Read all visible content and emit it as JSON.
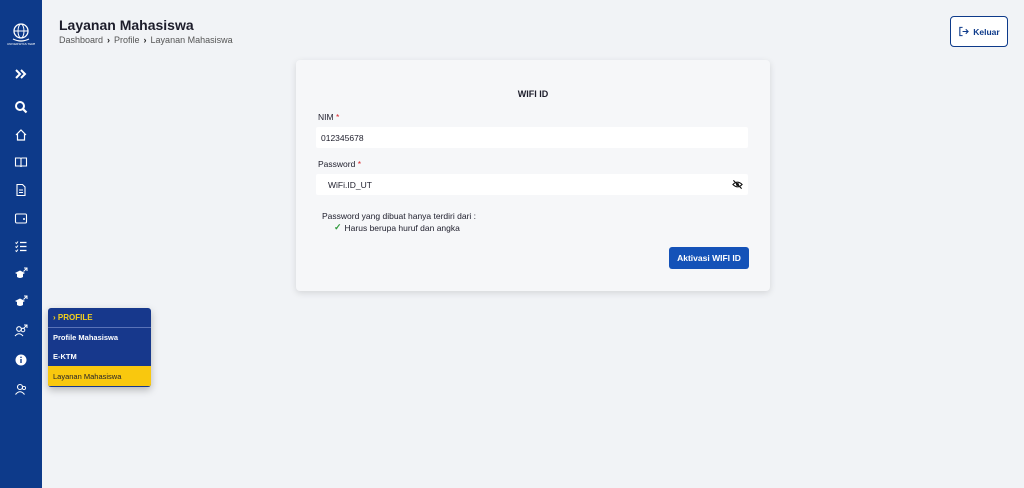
{
  "app": {
    "logo_text": "UNIVERSITAS TERBUKA",
    "logo_icon": "globe-emblem-icon"
  },
  "sidebar": {
    "items": [
      {
        "icon": "expand-chevrons-icon"
      },
      {
        "icon": "search-icon"
      },
      {
        "icon": "home-icon"
      },
      {
        "icon": "book-icon"
      },
      {
        "icon": "document-icon"
      },
      {
        "icon": "wallet-icon"
      },
      {
        "icon": "checklist-icon"
      },
      {
        "icon": "graduation-cap-external-icon"
      },
      {
        "icon": "graduation-cap-external-icon"
      },
      {
        "icon": "users-external-icon"
      },
      {
        "icon": "info-icon"
      },
      {
        "icon": "user-profile-icon"
      }
    ]
  },
  "flyout": {
    "header": "› PROFILE",
    "items": [
      {
        "label": "Profile Mahasiswa",
        "active": false
      },
      {
        "label": "E-KTM",
        "active": false
      },
      {
        "label": "Layanan Mahasiswa",
        "active": true
      }
    ]
  },
  "header": {
    "title": "Layanan Mahasiswa",
    "breadcrumb": [
      "Dashboard",
      "Profile",
      "Layanan Mahasiswa"
    ],
    "logout_label": "Keluar"
  },
  "form": {
    "title": "WIFI ID",
    "nim_label": "NIM",
    "nim_value": "012345678",
    "password_label": "Password",
    "password_value": "WiFi.ID_UT",
    "required_mark": "*",
    "hint": "Password yang dibuat hanya terdiri dari :",
    "rule": "Harus berupa huruf dan angka",
    "submit_label": "Aktivasi WIFI ID"
  },
  "colors": {
    "sidebar": "#0d3a8a",
    "accent_yellow": "#f9c80e",
    "button": "#1452b8",
    "required": "#d8232a",
    "check": "#2e9a3b"
  }
}
